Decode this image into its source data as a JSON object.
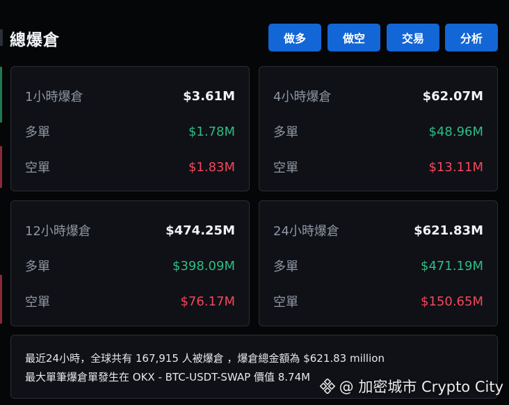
{
  "header": {
    "title": "總爆倉",
    "buttons": [
      "做多",
      "做空",
      "交易",
      "分析"
    ]
  },
  "cards": [
    {
      "period": "1小時爆倉",
      "total": "$3.61M",
      "long_label": "多單",
      "long": "$1.78M",
      "short_label": "空單",
      "short": "$1.83M"
    },
    {
      "period": "4小時爆倉",
      "total": "$62.07M",
      "long_label": "多單",
      "long": "$48.96M",
      "short_label": "空單",
      "short": "$13.11M"
    },
    {
      "period": "12小時爆倉",
      "total": "$474.25M",
      "long_label": "多單",
      "long": "$398.09M",
      "short_label": "空單",
      "short": "$76.17M"
    },
    {
      "period": "24小時爆倉",
      "total": "$621.83M",
      "long_label": "多單",
      "long": "$471.19M",
      "short_label": "空單",
      "short": "$150.65M"
    }
  ],
  "summary": {
    "line1": "最近24小時，全球共有 167,915 人被爆倉 ，爆倉總金額為 $621.83 million",
    "line2": "最大單筆爆倉單發生在 OKX - BTC-USDT-SWAP 價值 8.74M"
  },
  "watermark": {
    "text": "@ 加密城市 Crypto City"
  },
  "colors": {
    "accent": "#1366d6",
    "long": "#2ebd85",
    "short": "#f6465d",
    "card_bg": "#0f1116",
    "page_bg": "#050608"
  }
}
